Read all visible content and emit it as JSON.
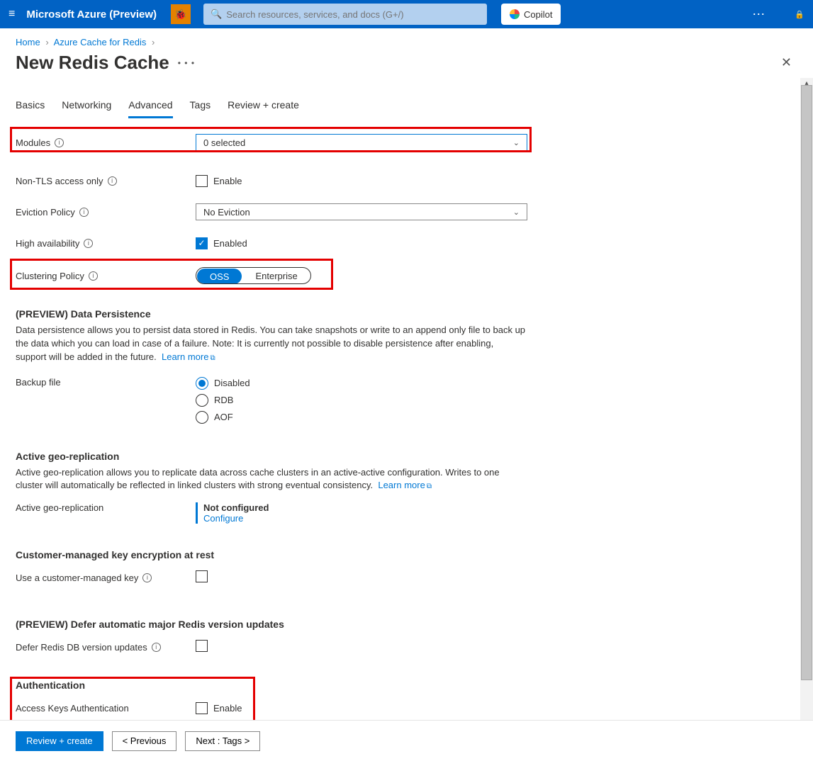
{
  "topbar": {
    "brand": "Microsoft Azure (Preview)",
    "search_placeholder": "Search resources, services, and docs (G+/)",
    "copilot": "Copilot"
  },
  "breadcrumb": {
    "home": "Home",
    "parent": "Azure Cache for Redis"
  },
  "page_title": "New Redis Cache",
  "tabs": [
    "Basics",
    "Networking",
    "Advanced",
    "Tags",
    "Review + create"
  ],
  "active_tab": "Advanced",
  "fields": {
    "modules_label": "Modules",
    "modules_value": "0 selected",
    "nontls_label": "Non-TLS access only",
    "nontls_cb": "Enable",
    "eviction_label": "Eviction Policy",
    "eviction_value": "No Eviction",
    "ha_label": "High availability",
    "ha_cb": "Enabled",
    "cluster_label": "Clustering Policy",
    "cluster_opts": [
      "OSS",
      "Enterprise"
    ]
  },
  "persistence": {
    "heading": "(PREVIEW) Data Persistence",
    "desc": "Data persistence allows you to persist data stored in Redis. You can take snapshots or write to an append only file to back up the data which you can load in case of a failure. Note: It is currently not possible to disable persistence after enabling, support will be added in the future.",
    "learn": "Learn more",
    "backup_label": "Backup file",
    "options": [
      "Disabled",
      "RDB",
      "AOF"
    ],
    "selected": "Disabled"
  },
  "geo": {
    "heading": "Active geo-replication",
    "desc": "Active geo-replication allows you to replicate data across cache clusters in an active-active configuration. Writes to one cluster will automatically be reflected in linked clusters with strong eventual consistency.",
    "learn": "Learn more",
    "row_label": "Active geo-replication",
    "status": "Not configured",
    "configure": "Configure"
  },
  "cmk": {
    "heading": "Customer-managed key encryption at rest",
    "label": "Use a customer-managed key"
  },
  "defer": {
    "heading": "(PREVIEW) Defer automatic major Redis version updates",
    "label": "Defer Redis DB version updates"
  },
  "auth": {
    "heading": "Authentication",
    "label": "Access Keys Authentication",
    "cb": "Enable"
  },
  "footer": {
    "review": "Review + create",
    "prev": "<  Previous",
    "next": "Next : Tags  >"
  }
}
